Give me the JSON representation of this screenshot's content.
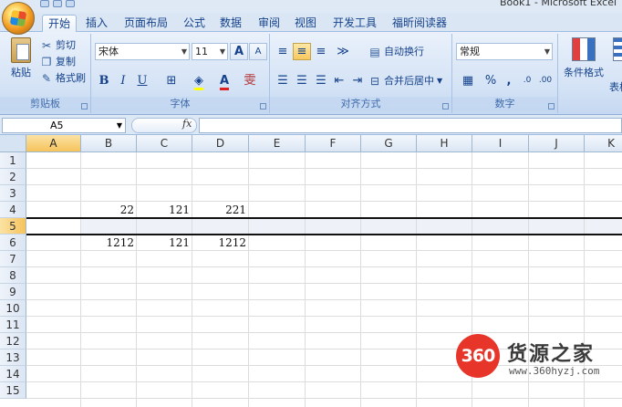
{
  "window": {
    "title": "Book1 - Microsoft Excel"
  },
  "tabs": [
    {
      "label": "开始",
      "active": true
    },
    {
      "label": "插入"
    },
    {
      "label": "页面布局"
    },
    {
      "label": "公式"
    },
    {
      "label": "数据"
    },
    {
      "label": "审阅"
    },
    {
      "label": "视图"
    },
    {
      "label": "开发工具"
    },
    {
      "label": "福昕阅读器"
    }
  ],
  "ribbon": {
    "clipboard": {
      "label": "剪贴板",
      "paste": "粘贴",
      "cut": "剪切",
      "copy": "复制",
      "format_painter": "格式刷"
    },
    "font": {
      "label": "字体",
      "name": "宋体",
      "size": "11"
    },
    "alignment": {
      "label": "对齐方式",
      "wrap_text": "自动换行",
      "merge_center": "合并后居中"
    },
    "number": {
      "label": "数字",
      "format": "常规",
      "percent": "%",
      "comma": ","
    },
    "styles": {
      "conditional_format": "条件格式",
      "table_format": "表格"
    }
  },
  "formula_bar": {
    "name_box": "A5",
    "fx": "fx",
    "content": ""
  },
  "grid": {
    "columns": [
      "A",
      "B",
      "C",
      "D",
      "E",
      "F",
      "G",
      "H",
      "I",
      "J",
      "K"
    ],
    "rows": [
      "1",
      "2",
      "3",
      "4",
      "5",
      "6",
      "7",
      "8",
      "9",
      "10",
      "11",
      "12",
      "13",
      "14",
      "15"
    ],
    "active_row": "5",
    "active_cell": "A5",
    "cells": {
      "B4": "22",
      "C4": "121",
      "D4": "221",
      "B6": "1212",
      "C6": "121",
      "D6": "1212"
    }
  },
  "watermark": {
    "badge": "360",
    "title": "货源之家",
    "url": "www.360hyzj.com"
  }
}
